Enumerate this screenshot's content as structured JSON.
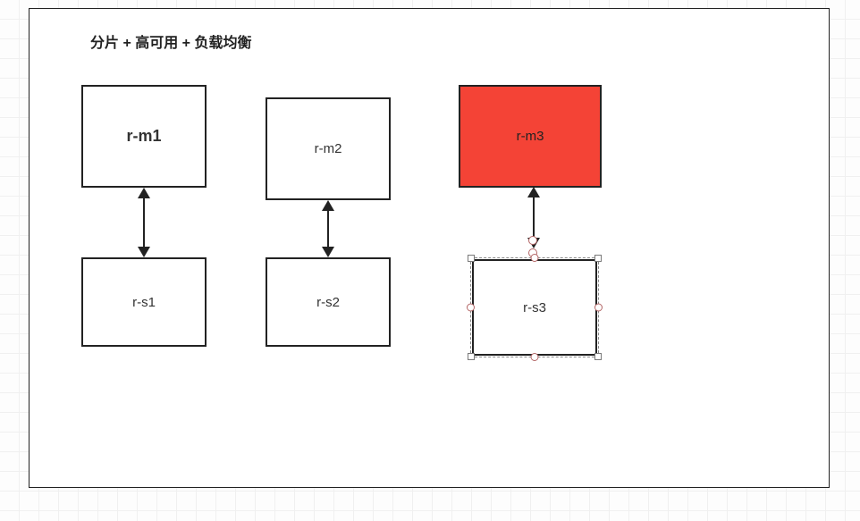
{
  "title": "分片 + 高可用 + 负载均衡",
  "nodes": {
    "m1": {
      "label": "r-m1"
    },
    "m2": {
      "label": "r-m2"
    },
    "m3": {
      "label": "r-m3",
      "fill": "#f44336"
    },
    "s1": {
      "label": "r-s1"
    },
    "s2": {
      "label": "r-s2"
    },
    "s3": {
      "label": "r-s3",
      "selected": true
    }
  },
  "connections": [
    {
      "from": "m1",
      "to": "s1",
      "kind": "double-arrow"
    },
    {
      "from": "m2",
      "to": "s2",
      "kind": "double-arrow"
    },
    {
      "from": "m3",
      "to": "s3",
      "kind": "double-arrow"
    }
  ]
}
